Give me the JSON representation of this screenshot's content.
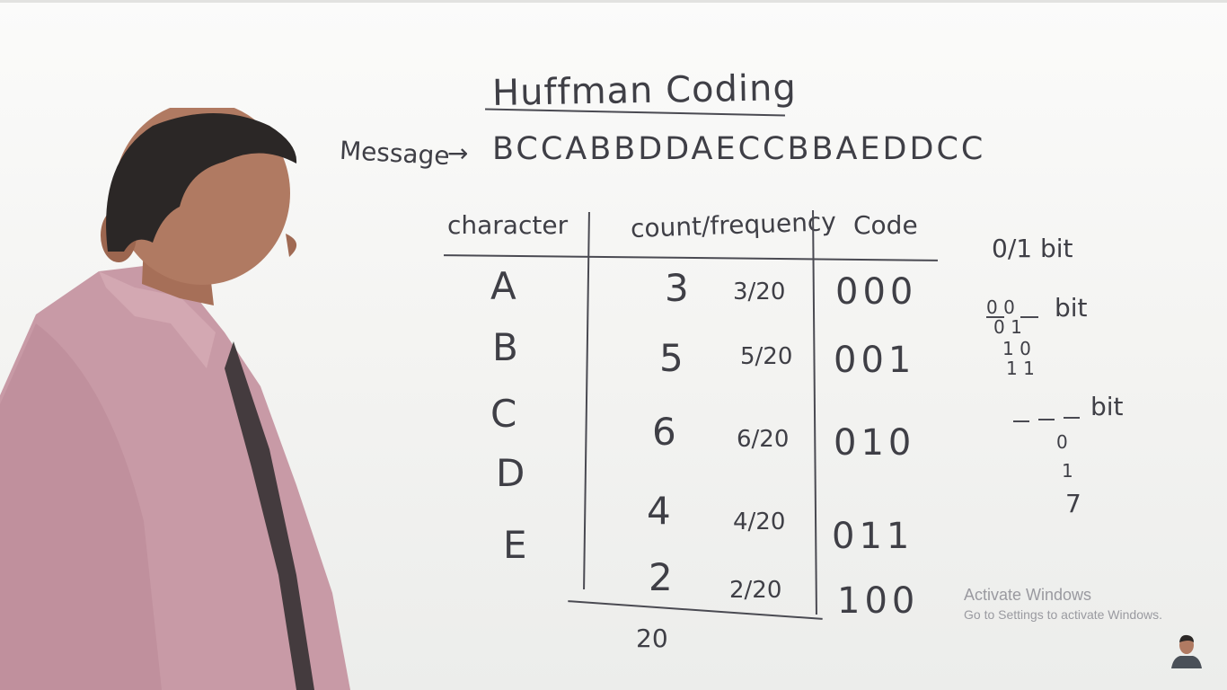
{
  "title": "Huffman Coding",
  "message": {
    "label": "Message",
    "arrow": "→",
    "text": "BCCABBDDAECCBBAEDDCC"
  },
  "table": {
    "headers": {
      "character": "character",
      "count": "count/frequency",
      "code": "Code"
    },
    "rows": [
      {
        "character": "A",
        "count": "3",
        "frequency": "3/20",
        "code": "000"
      },
      {
        "character": "B",
        "count": "5",
        "frequency": "5/20",
        "code": "001"
      },
      {
        "character": "C",
        "count": "6",
        "frequency": "6/20",
        "code": "010"
      },
      {
        "character": "D",
        "count": "4",
        "frequency": "4/20",
        "code": "011"
      },
      {
        "character": "E",
        "count": "2",
        "frequency": "2/20",
        "code": "100"
      }
    ],
    "total": "20"
  },
  "side_notes": {
    "one_bit": "0/1 bit",
    "two_bit_label": "bit",
    "two_bit_codes": [
      "0 0",
      "0 1",
      "1 0",
      "1 1"
    ],
    "three_bit_label": "bit",
    "three_bit_values": [
      "0",
      "1",
      "7"
    ]
  },
  "watermark": {
    "title": "Activate Windows",
    "subtitle": "Go to Settings to activate Windows."
  },
  "colors": {
    "board": "#f4f4f2",
    "ink": "#3f3f46",
    "shirt": "#c89aa6",
    "hair": "#2b2726",
    "skin": "#b07a62"
  }
}
